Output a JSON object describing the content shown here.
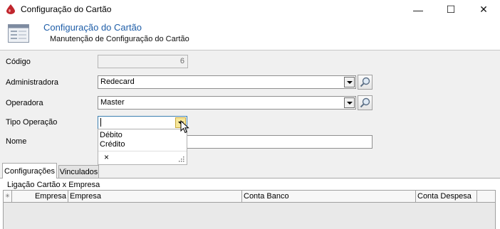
{
  "window": {
    "title": "Configuração do Cartão",
    "minimize_glyph": "—",
    "maximize_glyph": "☐",
    "close_glyph": "✕"
  },
  "header": {
    "title": "Configuração do Cartão",
    "subtitle": "Manutenção de Configuração do Cartão"
  },
  "form": {
    "codigo": {
      "label": "Código",
      "value": "6"
    },
    "administradora": {
      "label": "Administradora",
      "value": "Redecard"
    },
    "operadora": {
      "label": "Operadora",
      "value": "Master"
    },
    "tipo_operacao": {
      "label": "Tipo Operação",
      "value": "",
      "options": [
        "Débito",
        "Crédito"
      ],
      "clear_glyph": "×"
    },
    "nome": {
      "label": "Nome",
      "value": ""
    }
  },
  "tabs": [
    {
      "label": "Configurações",
      "active": true
    },
    {
      "label": "Vinculados",
      "active": false
    }
  ],
  "grid": {
    "caption": "Ligação Cartão x Empresa",
    "columns": [
      "Empresa",
      "Empresa",
      "Conta Banco",
      "Conta Despesa"
    ],
    "row_indicator": "✳"
  },
  "colors": {
    "accent": "#1f5ea8",
    "form_bg": "#f0f0f0",
    "app_icon": "#c0262d"
  }
}
